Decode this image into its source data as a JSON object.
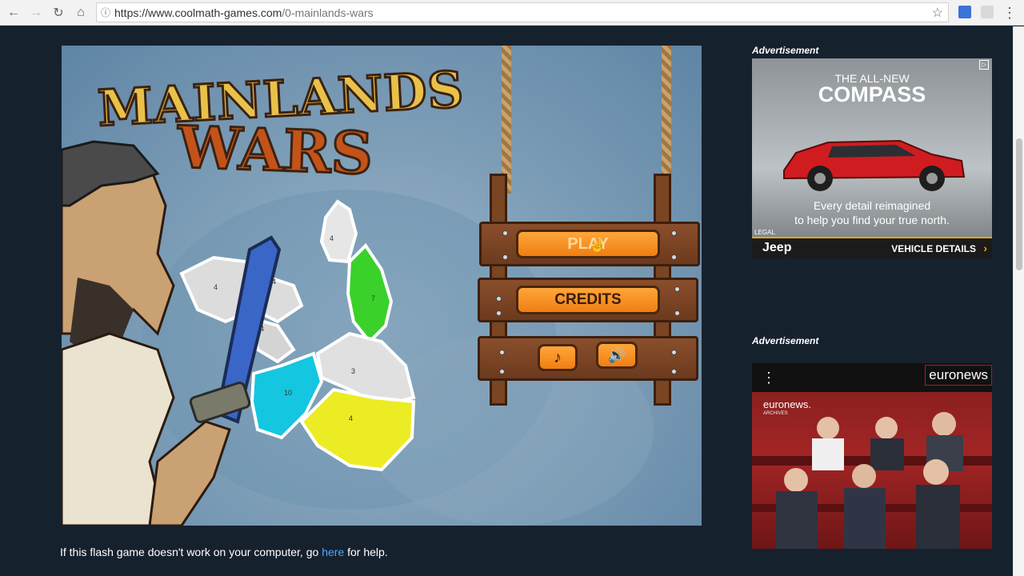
{
  "browser": {
    "url_host": "https://www.coolmath-games.com",
    "url_path": "/0-mainlands-wars"
  },
  "game": {
    "title_line1": "MAINLANDS",
    "title_line2": "WARS",
    "play_label": "PLAY",
    "credits_label": "CREDITS",
    "music_icon": "music-note-icon",
    "sound_icon": "speaker-icon",
    "regions": [
      {
        "id": "north",
        "label": "4"
      },
      {
        "id": "west",
        "label": "4"
      },
      {
        "id": "west2",
        "label": "4"
      },
      {
        "id": "green",
        "label": "7"
      },
      {
        "id": "mid",
        "label": "4"
      },
      {
        "id": "center",
        "label": "3"
      },
      {
        "id": "cyan",
        "label": "10"
      },
      {
        "id": "yellow",
        "label": "4"
      }
    ]
  },
  "help_text": {
    "before": "If this flash game doesn't work on your computer, go ",
    "link": "here",
    "after": " for help."
  },
  "ads": {
    "label": "Advertisement",
    "jeep": {
      "headline_small": "THE ALL-NEW",
      "headline_big": "COMPASS",
      "tagline_1": "Every detail reimagined",
      "tagline_2": "to help you find your true north.",
      "legal": "LEGAL",
      "brand": "Jeep",
      "cta": "VEHICLE DETAILS"
    },
    "euronews": {
      "brand": "euronews",
      "inset_brand": "euronews.",
      "inset_sub": "ARCHIVES"
    }
  },
  "colors": {
    "page_bg": "#16212e",
    "link": "#4fa7ff",
    "button_orange": "#f58a1f",
    "jeep_red": "#d01c20"
  }
}
